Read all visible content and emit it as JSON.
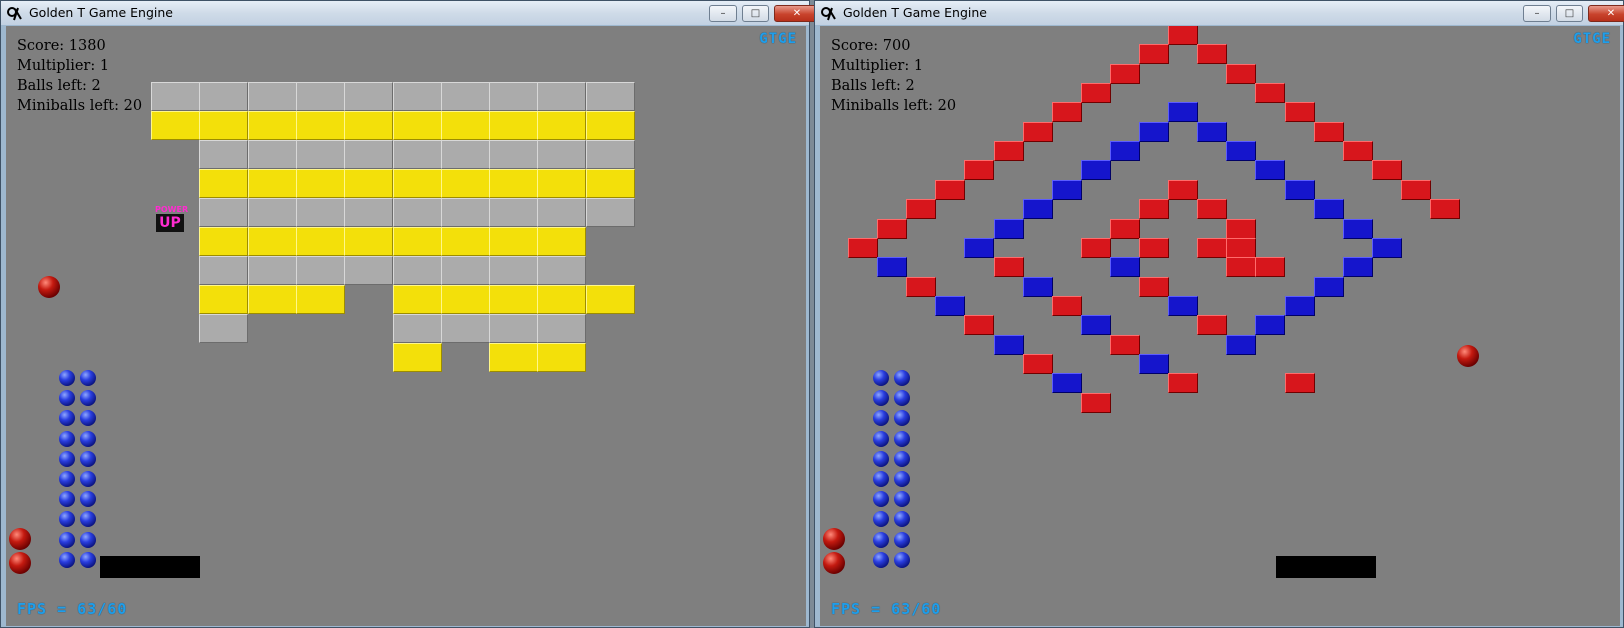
{
  "windows": [
    {
      "title": "Golden T Game Engine",
      "controls": {
        "minimize": "minimize-icon",
        "maximize": "maximize-icon",
        "close": "close-icon"
      },
      "hud": {
        "score": "Score: 1380",
        "multiplier": "Multiplier: 1",
        "balls_left": "Balls left: 2",
        "miniballs_left": "Miniballs left: 20"
      },
      "logo": "GTGE",
      "fps": "FPS = 63/60",
      "powerup": {
        "line1": "POWER",
        "line2": "UP"
      }
    },
    {
      "title": "Golden T Game Engine",
      "controls": {
        "minimize": "minimize-icon",
        "maximize": "maximize-icon",
        "close": "close-icon"
      },
      "hud": {
        "score": "Score: 700",
        "multiplier": "Multiplier: 1",
        "balls_left": "Balls left: 2",
        "miniballs_left": "Miniballs left: 20"
      },
      "logo": "GTGE",
      "fps": "FPS = 63/60"
    }
  ],
  "colors": {
    "brick_gray": "#ababab",
    "brick_yellow": "#f3e00a",
    "brick_red": "#d7161c",
    "brick_blue": "#1515cc",
    "background": "#7f7f7f",
    "logo_blue": "#1f9eea"
  }
}
